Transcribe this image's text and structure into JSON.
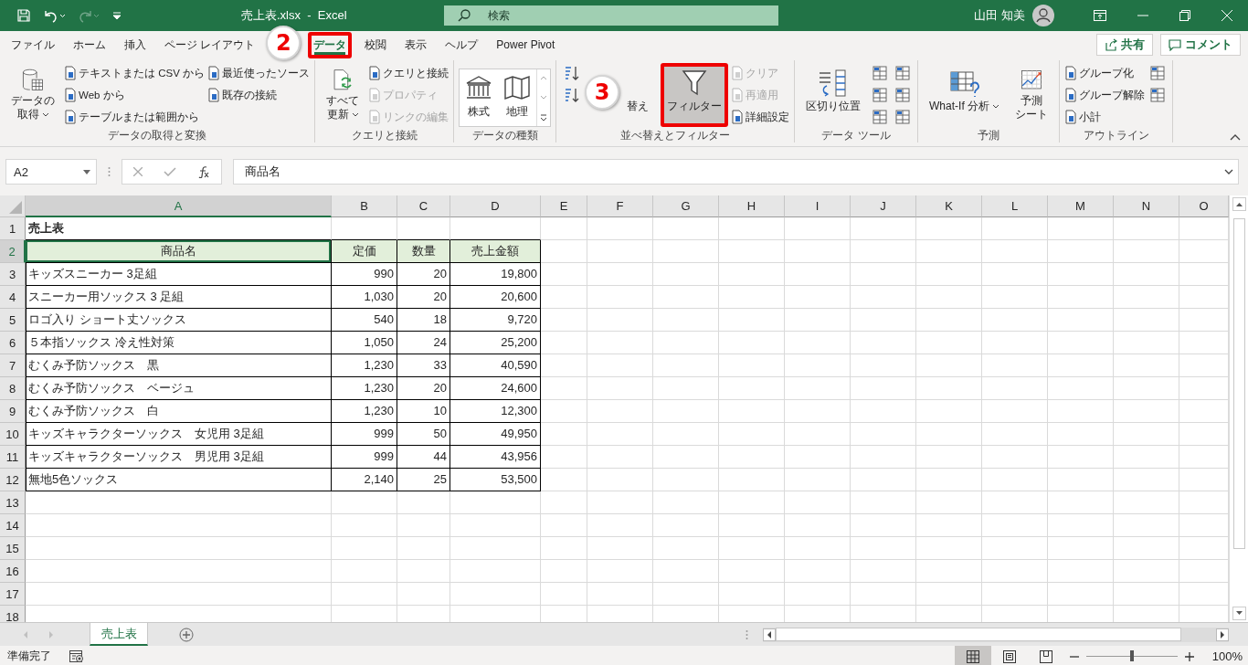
{
  "window": {
    "title": "売上表.xlsx  -  Excel",
    "search_placeholder": "検索",
    "user": "山田 知美"
  },
  "tabs": [
    {
      "label": "ファイル",
      "selected": false,
      "highlighted": false
    },
    {
      "label": "ホーム",
      "selected": false,
      "highlighted": false
    },
    {
      "label": "挿入",
      "selected": false,
      "highlighted": false
    },
    {
      "label": "ページ レイアウト",
      "selected": false,
      "highlighted": false
    },
    {
      "label": "データ",
      "selected": true,
      "highlighted": true
    },
    {
      "label": "校閲",
      "selected": false,
      "highlighted": false
    },
    {
      "label": "表示",
      "selected": false,
      "highlighted": false
    },
    {
      "label": "ヘルプ",
      "selected": false,
      "highlighted": false
    },
    {
      "label": "Power Pivot",
      "selected": false,
      "highlighted": false
    }
  ],
  "share_button": "共有",
  "comment_button": "コメント",
  "callouts": [
    {
      "label": "2"
    },
    {
      "label": "3"
    }
  ],
  "ribbon": {
    "groups": [
      {
        "label": "データの取得と変換",
        "columns": [
          [
            {
              "kind": "large",
              "lines": [
                "データの",
                "取得"
              ],
              "dropdown": true,
              "disabled": false,
              "selected": false,
              "highlighted": false
            }
          ],
          [
            {
              "kind": "small",
              "label": "テキストまたは CSV から",
              "disabled": false
            },
            {
              "kind": "small",
              "label": "Web から",
              "disabled": false
            },
            {
              "kind": "small",
              "label": "テーブルまたは範囲から",
              "disabled": false
            }
          ],
          [
            {
              "kind": "small",
              "label": "最近使ったソース",
              "disabled": false
            },
            {
              "kind": "small",
              "label": "既存の接続",
              "disabled": false
            }
          ]
        ]
      },
      {
        "label": "クエリと接続",
        "columns": [
          [
            {
              "kind": "large",
              "lines": [
                "すべて",
                "更新"
              ],
              "dropdown": true,
              "disabled": false,
              "selected": false,
              "highlighted": false
            }
          ],
          [
            {
              "kind": "small",
              "label": "クエリと接続",
              "disabled": false
            },
            {
              "kind": "small",
              "label": "プロパティ",
              "disabled": true
            },
            {
              "kind": "small",
              "label": "リンクの編集",
              "disabled": true
            }
          ]
        ]
      },
      {
        "label": "データの種類",
        "columns": [
          [
            {
              "kind": "gallery",
              "items": [
                "株式",
                "地理"
              ]
            }
          ]
        ]
      },
      {
        "label": "並べ替えとフィルター",
        "columns": [
          [
            {
              "kind": "icon"
            },
            {
              "kind": "icon"
            }
          ],
          [
            {
              "kind": "large",
              "lines": [
                "替え"
              ],
              "dropdown": false,
              "disabled": false,
              "selected": false,
              "highlighted": false
            }
          ],
          [
            {
              "kind": "large",
              "lines": [
                "フィルター"
              ],
              "dropdown": false,
              "disabled": false,
              "selected": true,
              "highlighted": true
            }
          ],
          [
            {
              "kind": "small",
              "label": "クリア",
              "disabled": true
            },
            {
              "kind": "small",
              "label": "再適用",
              "disabled": true
            },
            {
              "kind": "small",
              "label": "詳細設定",
              "disabled": false
            }
          ]
        ]
      },
      {
        "label": "データ ツール",
        "columns": [
          [
            {
              "kind": "large",
              "lines": [
                "区切り位置"
              ],
              "dropdown": false,
              "disabled": false,
              "selected": false,
              "highlighted": false
            }
          ],
          [
            {
              "kind": "icon"
            },
            {
              "kind": "icon"
            },
            {
              "kind": "icon"
            }
          ],
          [
            {
              "kind": "icon"
            },
            {
              "kind": "icon"
            },
            {
              "kind": "icon"
            }
          ]
        ]
      },
      {
        "label": "予測",
        "columns": [
          [
            {
              "kind": "large",
              "lines": [
                "What-If 分析"
              ],
              "dropdown": true,
              "disabled": false,
              "selected": false,
              "highlighted": false
            }
          ],
          [
            {
              "kind": "large",
              "lines": [
                "予測",
                "シート"
              ],
              "dropdown": false,
              "disabled": false,
              "selected": false,
              "highlighted": false
            }
          ]
        ]
      },
      {
        "label": "アウトライン",
        "columns": [
          [
            {
              "kind": "small",
              "label": "グループ化",
              "disabled": false
            },
            {
              "kind": "small",
              "label": "グループ解除",
              "disabled": false
            },
            {
              "kind": "small",
              "label": "小計",
              "disabled": false
            }
          ],
          [
            {
              "kind": "icon"
            },
            {
              "kind": "icon"
            }
          ]
        ]
      }
    ]
  },
  "formula_bar": {
    "name_box": "A2",
    "formula": "商品名"
  },
  "sheet": {
    "columns": [
      {
        "label": "A",
        "selected": true
      },
      {
        "label": "B",
        "selected": false
      },
      {
        "label": "C",
        "selected": false
      },
      {
        "label": "D",
        "selected": false
      },
      {
        "label": "E",
        "selected": false
      },
      {
        "label": "F",
        "selected": false
      },
      {
        "label": "G",
        "selected": false
      },
      {
        "label": "H",
        "selected": false
      },
      {
        "label": "I",
        "selected": false
      },
      {
        "label": "J",
        "selected": false
      },
      {
        "label": "K",
        "selected": false
      },
      {
        "label": "L",
        "selected": false
      },
      {
        "label": "M",
        "selected": false
      },
      {
        "label": "N",
        "selected": false
      },
      {
        "label": "O",
        "selected": false
      }
    ],
    "rows": [
      {
        "number": "1",
        "kind": "title",
        "selected": false,
        "cells": [
          "売上表"
        ]
      },
      {
        "number": "2",
        "kind": "header",
        "selected": true,
        "cells": [
          "商品名",
          "定価",
          "数量",
          "売上金額"
        ]
      },
      {
        "number": "3",
        "kind": "data",
        "selected": false,
        "cells": [
          "キッズスニーカー 3足組",
          "990",
          "20",
          "19,800"
        ]
      },
      {
        "number": "4",
        "kind": "data",
        "selected": false,
        "cells": [
          "スニーカー用ソックス 3 足組",
          "1,030",
          "20",
          "20,600"
        ]
      },
      {
        "number": "5",
        "kind": "data",
        "selected": false,
        "cells": [
          "ロゴ入り ショート丈ソックス",
          "540",
          "18",
          "9,720"
        ]
      },
      {
        "number": "6",
        "kind": "data",
        "selected": false,
        "cells": [
          "５本指ソックス 冷え性対策",
          "1,050",
          "24",
          "25,200"
        ]
      },
      {
        "number": "7",
        "kind": "data",
        "selected": false,
        "cells": [
          "むくみ予防ソックス　黒",
          "1,230",
          "33",
          "40,590"
        ]
      },
      {
        "number": "8",
        "kind": "data",
        "selected": false,
        "cells": [
          "むくみ予防ソックス　ベージュ",
          "1,230",
          "20",
          "24,600"
        ]
      },
      {
        "number": "9",
        "kind": "data",
        "selected": false,
        "cells": [
          "むくみ予防ソックス　白",
          "1,230",
          "10",
          "12,300"
        ]
      },
      {
        "number": "10",
        "kind": "data",
        "selected": false,
        "cells": [
          "キッズキャラクターソックス　女児用 3足組",
          "999",
          "50",
          "49,950"
        ]
      },
      {
        "number": "11",
        "kind": "data",
        "selected": false,
        "cells": [
          "キッズキャラクターソックス　男児用 3足組",
          "999",
          "44",
          "43,956"
        ]
      },
      {
        "number": "12",
        "kind": "data",
        "selected": false,
        "cells": [
          "無地5色ソックス",
          "2,140",
          "25",
          "53,500"
        ]
      },
      {
        "number": "13",
        "kind": "empty",
        "selected": false,
        "cells": []
      },
      {
        "number": "14",
        "kind": "empty",
        "selected": false,
        "cells": []
      },
      {
        "number": "15",
        "kind": "empty",
        "selected": false,
        "cells": []
      },
      {
        "number": "16",
        "kind": "empty",
        "selected": false,
        "cells": []
      },
      {
        "number": "17",
        "kind": "empty",
        "selected": false,
        "cells": []
      },
      {
        "number": "18",
        "kind": "empty",
        "selected": false,
        "cells": []
      }
    ]
  },
  "sheet_tabs": [
    {
      "label": "売上表",
      "selected": true
    }
  ],
  "status_bar": {
    "status": "準備完了",
    "zoom": "100%",
    "zoom_slider": {
      "level": 0.5
    }
  }
}
